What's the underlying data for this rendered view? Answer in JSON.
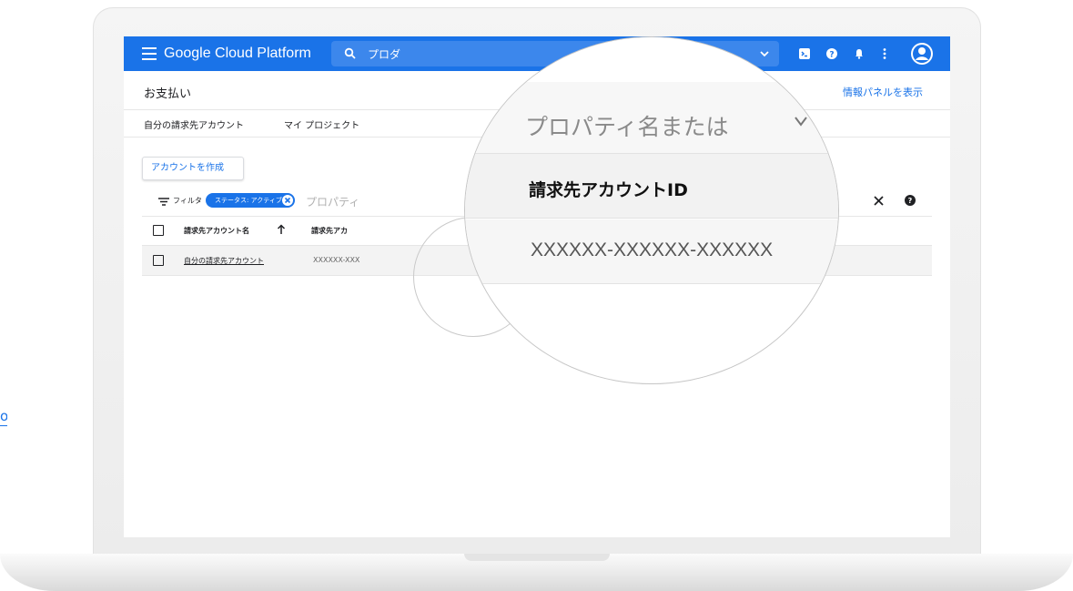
{
  "stray_link": "o",
  "topbar": {
    "app_title": "Google Cloud Platform",
    "search_placeholder": "プロダ"
  },
  "header": {
    "page_title": "お支払い",
    "info_panel_link": "情報パネルを表示"
  },
  "tabs": [
    {
      "label": "自分の請求先アカウント"
    },
    {
      "label": "マイ プロジェクト"
    }
  ],
  "create_button": "アカウントを作成",
  "filter": {
    "label": "フィルタ",
    "chip": "ステータス: アクティブ",
    "input_text": "プロパティ"
  },
  "table": {
    "headers": [
      "請求先アカウント名",
      "請求先アカ"
    ],
    "rows": [
      {
        "name": "自分の請求先アカウント",
        "id": "XXXXXX-XXX"
      }
    ]
  },
  "magnifier": {
    "search_text": "プロパティ名または",
    "column_header": "請求先アカウントID",
    "row_value": "XXXXXX-XXXXXX-XXXXXX"
  },
  "colors": {
    "accent": "#1a73e8"
  }
}
